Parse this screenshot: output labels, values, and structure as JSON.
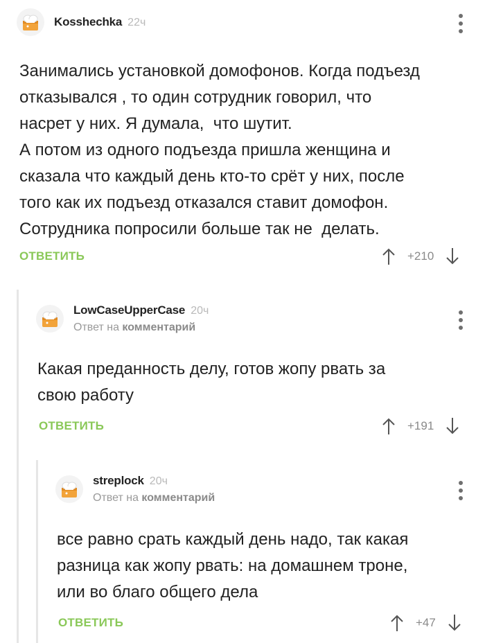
{
  "comments": [
    {
      "username": "Kosshechka",
      "time": "22ч",
      "reply_prefix": "",
      "reply_link": "",
      "text": "Занимались установкой домофонов. Когда подъезд\nотказывался , то один сотрудник говорил, что\nнасрет у них. Я думала,  что шутит.\nА потом из одного подъезда пришла женщина и\nсказала что каждый день кто-то срёт у них, после\nтого как их подъезд отказался ставит домофон.\nСотрудника попросили больше так не  делать.",
      "reply_label": "ОТВЕТИТЬ",
      "score": "+210"
    },
    {
      "username": "LowCaseUpperCase",
      "time": "20ч",
      "reply_prefix": "Ответ на",
      "reply_link": "комментарий",
      "text": "Какая преданность делу, готов жопу рвать за\nсвою работу",
      "reply_label": "ОТВЕТИТЬ",
      "score": "+191"
    },
    {
      "username": "streplock",
      "time": "20ч",
      "reply_prefix": "Ответ на",
      "reply_link": "комментарий",
      "text": "все равно срать каждый день надо, так какая\nразница как жопу рвать: на домашнем троне,\nили во благо общего дела",
      "reply_label": "ОТВЕТИТЬ",
      "score": "+47"
    }
  ],
  "colors": {
    "accent_green": "#8ac858",
    "thread_line": "#e6e6e6",
    "muted": "#9a9a9a"
  },
  "icons": {
    "avatar": "chef-hat-avatar-icon",
    "menu": "kebab-menu-icon",
    "upvote": "arrow-up-icon",
    "downvote": "arrow-down-icon"
  }
}
